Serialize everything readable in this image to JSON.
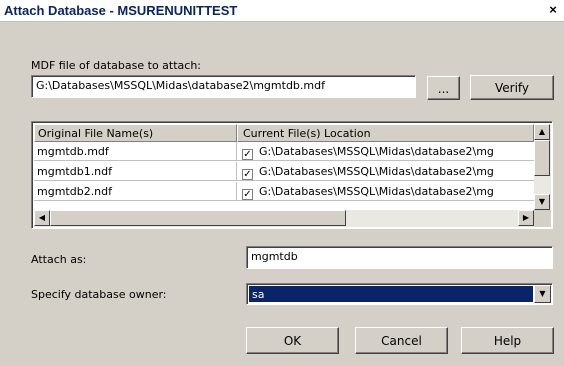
{
  "window": {
    "title": "Attach Database - MSURENUNITTEST",
    "close_glyph": "×"
  },
  "mdf": {
    "label": "MDF file of database to attach:",
    "value": "G:\\Databases\\MSSQL\\Midas\\database2\\mgmtdb.mdf",
    "browse_label": "...",
    "verify_label": "Verify"
  },
  "files_grid": {
    "columns": [
      "Original File Name(s)",
      "Current File(s) Location"
    ],
    "rows": [
      {
        "name": "mgmtdb.mdf",
        "checked": true,
        "location": "G:\\Databases\\MSSQL\\Midas\\database2\\mg"
      },
      {
        "name": "mgmtdb1.ndf",
        "checked": true,
        "location": "G:\\Databases\\MSSQL\\Midas\\database2\\mg"
      },
      {
        "name": "mgmtdb2.ndf",
        "checked": true,
        "location": "G:\\Databases\\MSSQL\\Midas\\database2\\mg"
      }
    ],
    "check_glyph": "✓"
  },
  "attach_as": {
    "label": "Attach as:",
    "value": "mgmtdb"
  },
  "owner": {
    "label": "Specify database owner:",
    "value": "sa"
  },
  "buttons": {
    "ok": "OK",
    "cancel": "Cancel",
    "help": "Help"
  },
  "colors": {
    "dialog_bg": "#d4d0c8",
    "title_text": "#0a246a",
    "selection": "#0a246a"
  }
}
